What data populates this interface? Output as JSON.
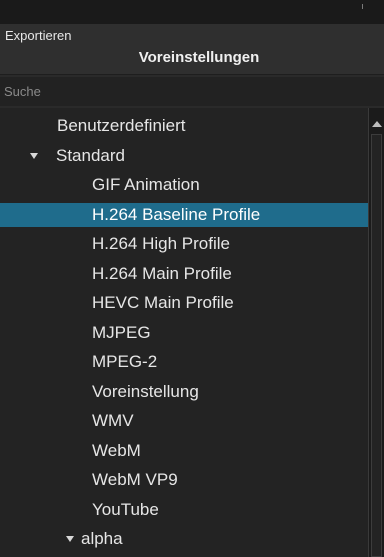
{
  "header": {
    "caption": "Exportieren",
    "title": "Voreinstellungen"
  },
  "search": {
    "placeholder": "Suche",
    "value": ""
  },
  "tree": {
    "items": [
      {
        "label": "Benutzerdefiniert",
        "kind": "item",
        "level": 0,
        "expanded": false,
        "selected": false
      },
      {
        "label": "Standard",
        "kind": "group",
        "level": 0,
        "expanded": true,
        "selected": false
      },
      {
        "label": "GIF Animation",
        "kind": "item",
        "level": 1,
        "expanded": false,
        "selected": false
      },
      {
        "label": "H.264 Baseline Profile",
        "kind": "item",
        "level": 1,
        "expanded": false,
        "selected": true
      },
      {
        "label": "H.264 High Profile",
        "kind": "item",
        "level": 1,
        "expanded": false,
        "selected": false
      },
      {
        "label": "H.264 Main Profile",
        "kind": "item",
        "level": 1,
        "expanded": false,
        "selected": false
      },
      {
        "label": "HEVC Main Profile",
        "kind": "item",
        "level": 1,
        "expanded": false,
        "selected": false
      },
      {
        "label": "MJPEG",
        "kind": "item",
        "level": 1,
        "expanded": false,
        "selected": false
      },
      {
        "label": "MPEG-2",
        "kind": "item",
        "level": 1,
        "expanded": false,
        "selected": false
      },
      {
        "label": "Voreinstellung",
        "kind": "item",
        "level": 1,
        "expanded": false,
        "selected": false
      },
      {
        "label": "WMV",
        "kind": "item",
        "level": 1,
        "expanded": false,
        "selected": false
      },
      {
        "label": "WebM",
        "kind": "item",
        "level": 1,
        "expanded": false,
        "selected": false
      },
      {
        "label": "WebM VP9",
        "kind": "item",
        "level": 1,
        "expanded": false,
        "selected": false
      },
      {
        "label": "YouTube",
        "kind": "item",
        "level": 1,
        "expanded": false,
        "selected": false
      },
      {
        "label": "alpha",
        "kind": "group",
        "level": 1,
        "expanded": true,
        "selected": false
      }
    ]
  },
  "icons": {
    "expand": "triangle-down-icon",
    "scroll_up": "triangle-up-icon"
  },
  "colors": {
    "background": "#2a2a2a",
    "tree_background": "#232323",
    "selection": "#1f6c8c",
    "text": "#e6e6e6"
  }
}
